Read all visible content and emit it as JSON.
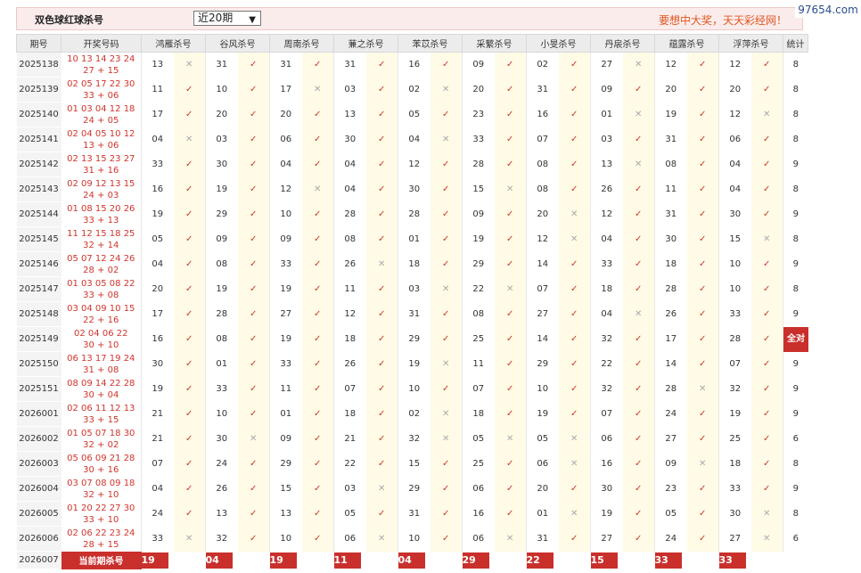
{
  "header": {
    "title": "双色球红球杀号",
    "period_select": "近20期",
    "slogan": "要想中大奖，天天彩经网！"
  },
  "watermark": "97654.com",
  "columns": [
    "期号",
    "开奖号码",
    "鸿雁杀号",
    "谷风杀号",
    "周南杀号",
    "蒹之杀号",
    "苯苡杀号",
    "采蘩杀号",
    "小旻杀号",
    "丹扆杀号",
    "蕴露杀号",
    "浮萍杀号",
    "统计"
  ],
  "rows": [
    {
      "issue": "2025138",
      "draw_line1": "10 13 14 23 24",
      "draw_line2": "27 + 15",
      "kills": [
        {
          "n": "13",
          "ok": false
        },
        {
          "n": "31",
          "ok": true
        },
        {
          "n": "31",
          "ok": true
        },
        {
          "n": "31",
          "ok": true
        },
        {
          "n": "16",
          "ok": true
        },
        {
          "n": "09",
          "ok": true
        },
        {
          "n": "02",
          "ok": true
        },
        {
          "n": "27",
          "ok": false
        },
        {
          "n": "12",
          "ok": true
        },
        {
          "n": "12",
          "ok": true
        }
      ],
      "stat": "8"
    },
    {
      "issue": "2025139",
      "draw_line1": "02 05 17 22 30",
      "draw_line2": "33 + 06",
      "kills": [
        {
          "n": "11",
          "ok": true
        },
        {
          "n": "10",
          "ok": true
        },
        {
          "n": "17",
          "ok": false
        },
        {
          "n": "03",
          "ok": true
        },
        {
          "n": "02",
          "ok": false
        },
        {
          "n": "20",
          "ok": true
        },
        {
          "n": "31",
          "ok": true
        },
        {
          "n": "09",
          "ok": true
        },
        {
          "n": "20",
          "ok": true
        },
        {
          "n": "20",
          "ok": true
        }
      ],
      "stat": "8"
    },
    {
      "issue": "2025140",
      "draw_line1": "01 03 04 12 18",
      "draw_line2": "24 + 05",
      "kills": [
        {
          "n": "17",
          "ok": true
        },
        {
          "n": "20",
          "ok": true
        },
        {
          "n": "20",
          "ok": true
        },
        {
          "n": "13",
          "ok": true
        },
        {
          "n": "05",
          "ok": true
        },
        {
          "n": "23",
          "ok": true
        },
        {
          "n": "16",
          "ok": true
        },
        {
          "n": "01",
          "ok": false
        },
        {
          "n": "19",
          "ok": true
        },
        {
          "n": "12",
          "ok": false
        }
      ],
      "stat": "8"
    },
    {
      "issue": "2025141",
      "draw_line1": "02 04 05 10 12",
      "draw_line2": "13 + 06",
      "kills": [
        {
          "n": "04",
          "ok": false
        },
        {
          "n": "03",
          "ok": true
        },
        {
          "n": "06",
          "ok": true
        },
        {
          "n": "30",
          "ok": true
        },
        {
          "n": "04",
          "ok": false
        },
        {
          "n": "33",
          "ok": true
        },
        {
          "n": "07",
          "ok": true
        },
        {
          "n": "03",
          "ok": true
        },
        {
          "n": "31",
          "ok": true
        },
        {
          "n": "06",
          "ok": true
        }
      ],
      "stat": "8"
    },
    {
      "issue": "2025142",
      "draw_line1": "02 13 15 23 27",
      "draw_line2": "31 + 16",
      "kills": [
        {
          "n": "33",
          "ok": true
        },
        {
          "n": "30",
          "ok": true
        },
        {
          "n": "04",
          "ok": true
        },
        {
          "n": "04",
          "ok": true
        },
        {
          "n": "12",
          "ok": true
        },
        {
          "n": "28",
          "ok": true
        },
        {
          "n": "08",
          "ok": true
        },
        {
          "n": "13",
          "ok": false
        },
        {
          "n": "08",
          "ok": true
        },
        {
          "n": "04",
          "ok": true
        }
      ],
      "stat": "9"
    },
    {
      "issue": "2025143",
      "draw_line1": "02 09 12 13 15",
      "draw_line2": "24 + 03",
      "kills": [
        {
          "n": "16",
          "ok": true
        },
        {
          "n": "19",
          "ok": true
        },
        {
          "n": "12",
          "ok": false
        },
        {
          "n": "04",
          "ok": true
        },
        {
          "n": "30",
          "ok": true
        },
        {
          "n": "15",
          "ok": false
        },
        {
          "n": "08",
          "ok": true
        },
        {
          "n": "26",
          "ok": true
        },
        {
          "n": "11",
          "ok": true
        },
        {
          "n": "04",
          "ok": true
        }
      ],
      "stat": "8"
    },
    {
      "issue": "2025144",
      "draw_line1": "01 08 15 20 26",
      "draw_line2": "33 + 13",
      "kills": [
        {
          "n": "19",
          "ok": true
        },
        {
          "n": "29",
          "ok": true
        },
        {
          "n": "10",
          "ok": true
        },
        {
          "n": "28",
          "ok": true
        },
        {
          "n": "28",
          "ok": true
        },
        {
          "n": "09",
          "ok": true
        },
        {
          "n": "20",
          "ok": false
        },
        {
          "n": "12",
          "ok": true
        },
        {
          "n": "31",
          "ok": true
        },
        {
          "n": "30",
          "ok": true
        }
      ],
      "stat": "9"
    },
    {
      "issue": "2025145",
      "draw_line1": "11 12 15 18 25",
      "draw_line2": "32 + 14",
      "kills": [
        {
          "n": "05",
          "ok": true
        },
        {
          "n": "09",
          "ok": true
        },
        {
          "n": "09",
          "ok": true
        },
        {
          "n": "08",
          "ok": true
        },
        {
          "n": "01",
          "ok": true
        },
        {
          "n": "19",
          "ok": true
        },
        {
          "n": "12",
          "ok": false
        },
        {
          "n": "04",
          "ok": true
        },
        {
          "n": "30",
          "ok": true
        },
        {
          "n": "15",
          "ok": false
        }
      ],
      "stat": "8"
    },
    {
      "issue": "2025146",
      "draw_line1": "05 07 12 24 26",
      "draw_line2": "28 + 02",
      "kills": [
        {
          "n": "04",
          "ok": true
        },
        {
          "n": "08",
          "ok": true
        },
        {
          "n": "33",
          "ok": true
        },
        {
          "n": "26",
          "ok": false
        },
        {
          "n": "18",
          "ok": true
        },
        {
          "n": "29",
          "ok": true
        },
        {
          "n": "14",
          "ok": true
        },
        {
          "n": "33",
          "ok": true
        },
        {
          "n": "18",
          "ok": true
        },
        {
          "n": "10",
          "ok": true
        }
      ],
      "stat": "9"
    },
    {
      "issue": "2025147",
      "draw_line1": "01 03 05 08 22",
      "draw_line2": "33 + 08",
      "kills": [
        {
          "n": "20",
          "ok": true
        },
        {
          "n": "19",
          "ok": true
        },
        {
          "n": "19",
          "ok": true
        },
        {
          "n": "11",
          "ok": true
        },
        {
          "n": "03",
          "ok": false
        },
        {
          "n": "22",
          "ok": false
        },
        {
          "n": "07",
          "ok": true
        },
        {
          "n": "18",
          "ok": true
        },
        {
          "n": "28",
          "ok": true
        },
        {
          "n": "10",
          "ok": true
        }
      ],
      "stat": "8"
    },
    {
      "issue": "2025148",
      "draw_line1": "03 04 09 10 15",
      "draw_line2": "22 + 16",
      "kills": [
        {
          "n": "17",
          "ok": true
        },
        {
          "n": "28",
          "ok": true
        },
        {
          "n": "27",
          "ok": true
        },
        {
          "n": "12",
          "ok": true
        },
        {
          "n": "31",
          "ok": true
        },
        {
          "n": "08",
          "ok": true
        },
        {
          "n": "27",
          "ok": true
        },
        {
          "n": "04",
          "ok": false
        },
        {
          "n": "26",
          "ok": true
        },
        {
          "n": "33",
          "ok": true
        }
      ],
      "stat": "9"
    },
    {
      "issue": "2025149",
      "draw_line1": "02 04 06 22",
      "draw_line2": "30 + 10",
      "kills": [
        {
          "n": "16",
          "ok": true
        },
        {
          "n": "08",
          "ok": true
        },
        {
          "n": "19",
          "ok": true
        },
        {
          "n": "18",
          "ok": true
        },
        {
          "n": "29",
          "ok": true
        },
        {
          "n": "25",
          "ok": true
        },
        {
          "n": "14",
          "ok": true
        },
        {
          "n": "32",
          "ok": true
        },
        {
          "n": "17",
          "ok": true
        },
        {
          "n": "28",
          "ok": true
        }
      ],
      "stat": "全对",
      "all_right": true
    },
    {
      "issue": "2025150",
      "draw_line1": "06 13 17 19 24",
      "draw_line2": "31 + 08",
      "kills": [
        {
          "n": "30",
          "ok": true
        },
        {
          "n": "01",
          "ok": true
        },
        {
          "n": "33",
          "ok": true
        },
        {
          "n": "26",
          "ok": true
        },
        {
          "n": "19",
          "ok": false
        },
        {
          "n": "11",
          "ok": true
        },
        {
          "n": "29",
          "ok": true
        },
        {
          "n": "22",
          "ok": true
        },
        {
          "n": "14",
          "ok": true
        },
        {
          "n": "07",
          "ok": true
        }
      ],
      "stat": "9"
    },
    {
      "issue": "2025151",
      "draw_line1": "08 09 14 22 28",
      "draw_line2": "30 + 04",
      "kills": [
        {
          "n": "19",
          "ok": true
        },
        {
          "n": "33",
          "ok": true
        },
        {
          "n": "11",
          "ok": true
        },
        {
          "n": "07",
          "ok": true
        },
        {
          "n": "10",
          "ok": true
        },
        {
          "n": "07",
          "ok": true
        },
        {
          "n": "10",
          "ok": true
        },
        {
          "n": "32",
          "ok": true
        },
        {
          "n": "28",
          "ok": false
        },
        {
          "n": "32",
          "ok": true
        }
      ],
      "stat": "9"
    },
    {
      "issue": "2026001",
      "draw_line1": "02 06 11 12 13",
      "draw_line2": "33 + 15",
      "kills": [
        {
          "n": "21",
          "ok": true
        },
        {
          "n": "10",
          "ok": true
        },
        {
          "n": "01",
          "ok": true
        },
        {
          "n": "18",
          "ok": true
        },
        {
          "n": "02",
          "ok": false
        },
        {
          "n": "18",
          "ok": true
        },
        {
          "n": "19",
          "ok": true
        },
        {
          "n": "07",
          "ok": true
        },
        {
          "n": "24",
          "ok": true
        },
        {
          "n": "19",
          "ok": true
        }
      ],
      "stat": "9"
    },
    {
      "issue": "2026002",
      "draw_line1": "01 05 07 18 30",
      "draw_line2": "32 + 02",
      "kills": [
        {
          "n": "21",
          "ok": true
        },
        {
          "n": "30",
          "ok": false
        },
        {
          "n": "09",
          "ok": true
        },
        {
          "n": "21",
          "ok": true
        },
        {
          "n": "32",
          "ok": false
        },
        {
          "n": "05",
          "ok": false
        },
        {
          "n": "05",
          "ok": false
        },
        {
          "n": "06",
          "ok": true
        },
        {
          "n": "27",
          "ok": true
        },
        {
          "n": "25",
          "ok": true
        }
      ],
      "stat": "6"
    },
    {
      "issue": "2026003",
      "draw_line1": "05 06 09 21 28",
      "draw_line2": "30 + 16",
      "kills": [
        {
          "n": "07",
          "ok": true
        },
        {
          "n": "24",
          "ok": true
        },
        {
          "n": "29",
          "ok": true
        },
        {
          "n": "22",
          "ok": true
        },
        {
          "n": "15",
          "ok": true
        },
        {
          "n": "25",
          "ok": true
        },
        {
          "n": "06",
          "ok": false
        },
        {
          "n": "16",
          "ok": true
        },
        {
          "n": "09",
          "ok": false
        },
        {
          "n": "18",
          "ok": true
        }
      ],
      "stat": "8"
    },
    {
      "issue": "2026004",
      "draw_line1": "03 07 08 09 18",
      "draw_line2": "32 + 10",
      "kills": [
        {
          "n": "04",
          "ok": true
        },
        {
          "n": "26",
          "ok": true
        },
        {
          "n": "15",
          "ok": true
        },
        {
          "n": "03",
          "ok": false
        },
        {
          "n": "29",
          "ok": true
        },
        {
          "n": "06",
          "ok": true
        },
        {
          "n": "20",
          "ok": true
        },
        {
          "n": "30",
          "ok": true
        },
        {
          "n": "23",
          "ok": true
        },
        {
          "n": "33",
          "ok": true
        }
      ],
      "stat": "9"
    },
    {
      "issue": "2026005",
      "draw_line1": "01 20 22 27 30",
      "draw_line2": "33 + 10",
      "kills": [
        {
          "n": "24",
          "ok": true
        },
        {
          "n": "13",
          "ok": true
        },
        {
          "n": "13",
          "ok": true
        },
        {
          "n": "05",
          "ok": true
        },
        {
          "n": "31",
          "ok": true
        },
        {
          "n": "16",
          "ok": true
        },
        {
          "n": "01",
          "ok": false
        },
        {
          "n": "19",
          "ok": true
        },
        {
          "n": "05",
          "ok": true
        },
        {
          "n": "30",
          "ok": false
        }
      ],
      "stat": "8"
    },
    {
      "issue": "2026006",
      "draw_line1": "02 06 22 23 24",
      "draw_line2": "28 + 15",
      "kills": [
        {
          "n": "33",
          "ok": false
        },
        {
          "n": "32",
          "ok": true
        },
        {
          "n": "10",
          "ok": true
        },
        {
          "n": "06",
          "ok": false
        },
        {
          "n": "10",
          "ok": true
        },
        {
          "n": "06",
          "ok": false
        },
        {
          "n": "31",
          "ok": true
        },
        {
          "n": "27",
          "ok": true
        },
        {
          "n": "24",
          "ok": true
        },
        {
          "n": "27",
          "ok": false
        }
      ],
      "stat": "6"
    }
  ],
  "current": {
    "issue": "2026007",
    "label": "当前期杀号",
    "picks": [
      "19",
      "04",
      "19",
      "11",
      "04",
      "29",
      "22",
      "15",
      "33",
      "33"
    ]
  },
  "marks": {
    "ok": "✓",
    "bad": "✕"
  }
}
